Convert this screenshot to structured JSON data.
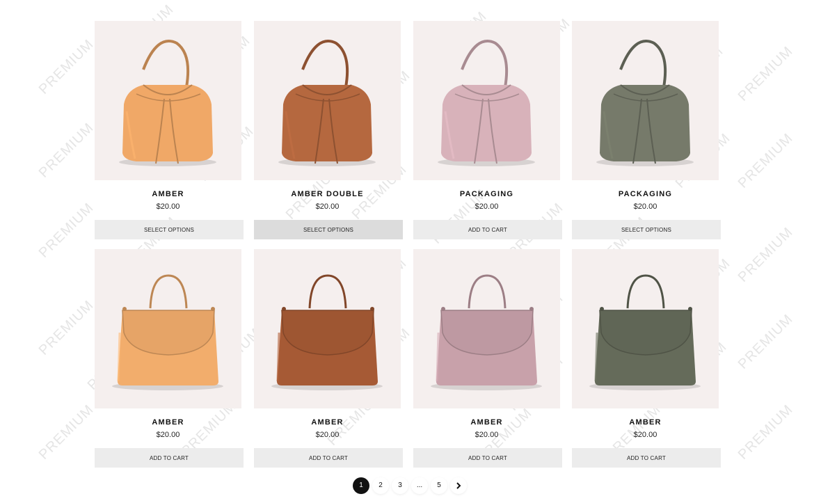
{
  "watermark": "PREMIUM",
  "products": [
    {
      "name": "AMBER",
      "price": "$20.00",
      "button": "SELECT OPTIONS",
      "style": "bucket",
      "color": "#f0a867"
    },
    {
      "name": "AMBER DOUBLE",
      "price": "$20.00",
      "button": "SELECT OPTIONS",
      "style": "bucket",
      "color": "#b5683f"
    },
    {
      "name": "PACKAGING",
      "price": "$20.00",
      "button": "ADD TO CART",
      "style": "bucket",
      "color": "#d8b2ba"
    },
    {
      "name": "PACKAGING",
      "price": "$20.00",
      "button": "SELECT OPTIONS",
      "style": "bucket",
      "color": "#767a6a"
    },
    {
      "name": "AMBER",
      "price": "$20.00",
      "button": "ADD TO CART",
      "style": "flap",
      "color": "#f2ad6c"
    },
    {
      "name": "AMBER",
      "price": "$20.00",
      "button": "ADD TO CART",
      "style": "flap",
      "color": "#a65a35"
    },
    {
      "name": "AMBER",
      "price": "$20.00",
      "button": "ADD TO CART",
      "style": "flap",
      "color": "#c8a1aa"
    },
    {
      "name": "AMBER",
      "price": "$20.00",
      "button": "ADD TO CART",
      "style": "flap",
      "color": "#656b5a"
    }
  ],
  "pagination": {
    "pages": [
      "1",
      "2",
      "3",
      "...",
      "5"
    ],
    "current": "1",
    "next_icon": "chevron-right-icon"
  }
}
